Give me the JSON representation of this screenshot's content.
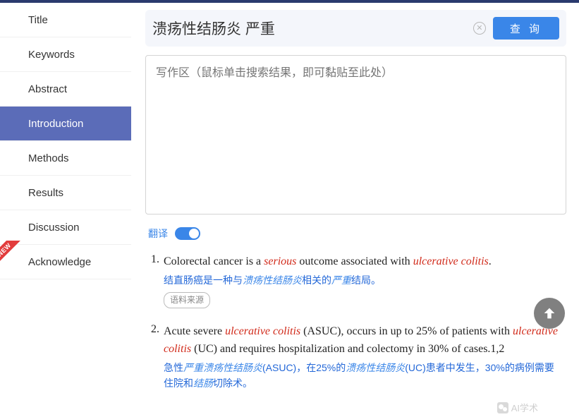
{
  "sidebar": {
    "items": [
      {
        "label": "Title"
      },
      {
        "label": "Keywords"
      },
      {
        "label": "Abstract"
      },
      {
        "label": "Introduction"
      },
      {
        "label": "Methods"
      },
      {
        "label": "Results"
      },
      {
        "label": "Discussion"
      },
      {
        "label": "Acknowledge"
      }
    ],
    "new_badge": "NEW"
  },
  "search": {
    "value": "溃疡性结肠炎 严重",
    "placeholder": "",
    "query_button": "查 询"
  },
  "writing": {
    "placeholder": "写作区（鼠标单击搜索结果，即可黏贴至此处）"
  },
  "translate": {
    "label": "翻译",
    "on": true
  },
  "src_label": "语料来源",
  "results": [
    {
      "num": "1.",
      "en_parts": [
        "Colorectal cancer is a ",
        "serious",
        " outcome associated with ",
        "ulcerative colitis",
        "."
      ],
      "cn_parts": [
        "结直肠癌是一种与",
        "溃疡性结肠炎",
        "相关的",
        "严重",
        "结局。"
      ],
      "show_src": true
    },
    {
      "num": "2.",
      "en_parts": [
        "Acute severe ",
        "ulcerative colitis",
        " (ASUC), occurs in up to 25% of patients with ",
        "ulcerative colitis",
        " (UC) and requires hospitalization and colectomy in 30% of cases.1,2"
      ],
      "cn_parts": [
        "急性",
        "严重溃疡性结肠炎",
        "(ASUC)，在25%的",
        "溃疡性结肠炎",
        "(UC)患者中发生，30%的病例需要住院和",
        "结肠",
        "切除术。"
      ],
      "show_src": false
    }
  ],
  "watermark": "AI学术"
}
